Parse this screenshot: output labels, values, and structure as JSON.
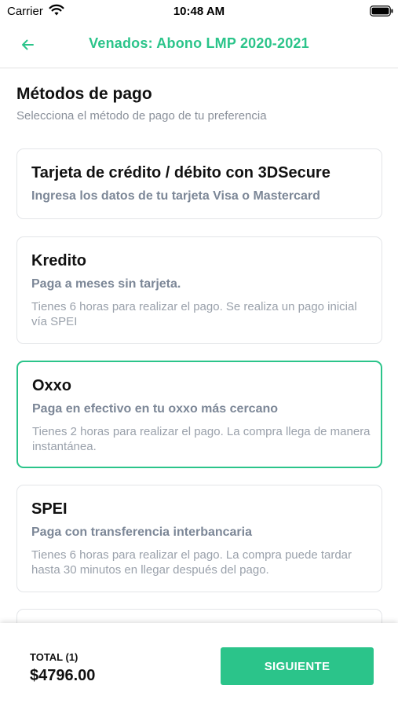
{
  "status_bar": {
    "carrier": "Carrier",
    "time": "10:48 AM",
    "wifi_icon": "wifi-icon",
    "battery_icon": "battery-icon"
  },
  "nav": {
    "back_icon": "arrow-left-icon",
    "title": "Venados: Abono LMP 2020-2021"
  },
  "section": {
    "title": "Métodos de pago",
    "subtitle": "Selecciona el método de pago de tu preferencia"
  },
  "methods": [
    {
      "title": "Tarjeta de crédito / débito con 3DSecure",
      "subtitle": "Ingresa los datos de tu tarjeta Visa o Mastercard",
      "note": "",
      "selected": false
    },
    {
      "title": "Kredito",
      "subtitle": "Paga a meses sin tarjeta.",
      "note": "Tienes 6 horas para realizar el pago. Se realiza un pago inicial vía SPEI",
      "selected": false
    },
    {
      "title": "Oxxo",
      "subtitle": "Paga en efectivo en tu oxxo más cercano",
      "note": "Tienes 2 horas para realizar el pago. La compra llega de manera instantánea.",
      "selected": true
    },
    {
      "title": "SPEI",
      "subtitle": "Paga con transferencia interbancaria",
      "note": "Tienes 6 horas para realizar el pago. La compra puede tardar hasta 30 minutos en llegar después del pago.",
      "selected": false
    }
  ],
  "footer": {
    "total_label": "TOTAL (1)",
    "total_amount": "$4796.00",
    "next_label": "SIGUIENTE"
  },
  "colors": {
    "accent": "#2bc48a",
    "card_border": "#e3e5e8",
    "subtitle_text": "#7c8797",
    "note_text": "#9aa1ab"
  }
}
